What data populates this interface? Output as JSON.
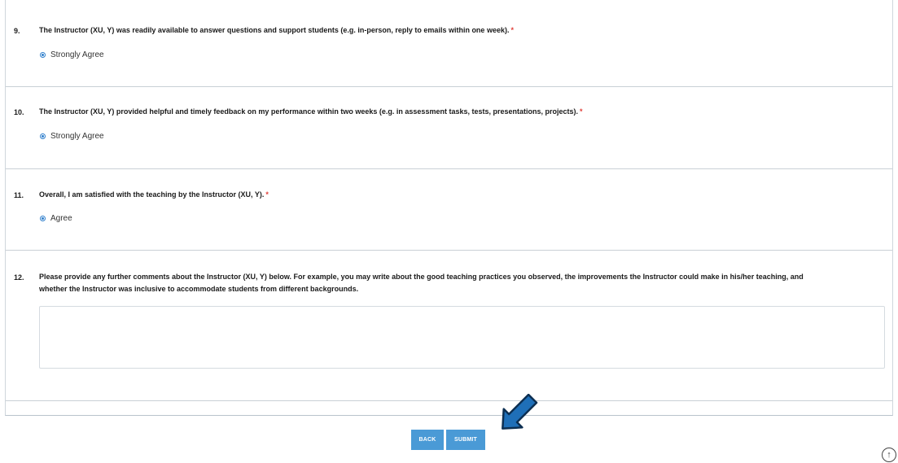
{
  "questions": [
    {
      "number": "9.",
      "text": "The Instructor (XU, Y) was readily available to answer questions and support students (e.g. in-person, reply to emails within one week).",
      "required_mark": "*",
      "answer": "Strongly Agree"
    },
    {
      "number": "10.",
      "text": "The Instructor (XU, Y) provided helpful and timely feedback on my performance within two weeks (e.g. in assessment tasks, tests, presentations, projects).",
      "required_mark": "*",
      "answer": "Strongly Agree"
    },
    {
      "number": "11.",
      "text": "Overall, I am satisfied with the teaching by the Instructor (XU, Y).",
      "required_mark": "*",
      "answer": "Agree"
    },
    {
      "number": "12.",
      "text_line1": "Please provide any further comments about the Instructor (XU, Y) below. For example, you may write about the good teaching practices you observed, the improvements the Instructor could make in his/her teaching, and",
      "text_line2": "whether the Instructor was inclusive to accommodate students from different backgrounds.",
      "comment_value": ""
    }
  ],
  "buttons": {
    "back_label": "BACK",
    "submit_label": "SUBMIT"
  },
  "icons": {
    "pointer_arrow": "arrow-down-left-icon",
    "scroll_top": "arrow-up-circle-icon"
  },
  "colors": {
    "accent": "#4a9ad6",
    "required": "#e0403a",
    "radio": "#2f7fcc",
    "arrow_fill": "#1f6fb8"
  }
}
